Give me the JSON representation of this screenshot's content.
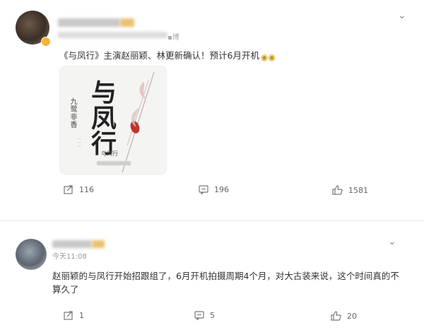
{
  "post1": {
    "source": "▪博",
    "text": "《与凤行》主演赵丽颖、林更新确认！预计6月开机",
    "emoji_icon": "sunglasses-emoji",
    "cover": {
      "title": "与凤行",
      "author": "九鹭非香",
      "subtitle": "与凤行"
    },
    "actions": {
      "repost_count": "116",
      "comment_count": "196",
      "like_count": "1581"
    }
  },
  "post2": {
    "time": "今天11:08",
    "text": "赵丽颖的与凤行开始招跟组了，6月开机拍摄周期4个月，对大古装来说，这个时间真的不算久了",
    "actions": {
      "repost_count": "1",
      "comment_count": "5",
      "like_count": "20"
    }
  },
  "icons": {
    "more": "chevron-down-icon",
    "repost": "share-icon",
    "comment": "comment-icon",
    "like": "thumbs-up-icon"
  },
  "colors": {
    "text": "#333333",
    "muted": "#999999",
    "badge": "#f7b43a"
  }
}
